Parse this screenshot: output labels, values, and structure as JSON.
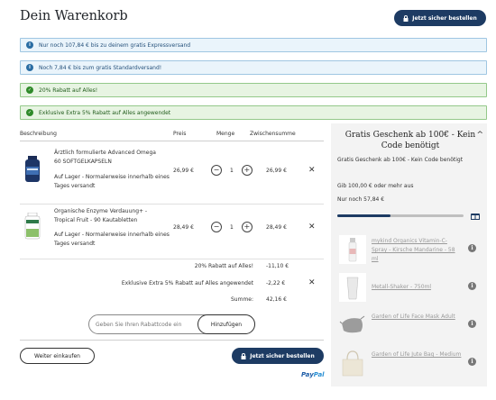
{
  "header": {
    "title": "Dein Warenkorb",
    "checkout_label": "Jetzt sicher bestellen"
  },
  "banners": [
    {
      "type": "info",
      "text": "Nur noch 107,84 € bis zu deinem gratis Expressversand"
    },
    {
      "type": "info",
      "text": "Noch 7,84 € bis zum gratis Standardversand!"
    },
    {
      "type": "success",
      "text": "20% Rabatt auf Alles!"
    },
    {
      "type": "success",
      "text": "Exklusive Extra 5% Rabatt auf Alles angewendet"
    }
  ],
  "table": {
    "headers": {
      "description": "Beschreibung",
      "price": "Preis",
      "quantity": "Menge",
      "subtotal": "Zwischensumme"
    },
    "items": [
      {
        "name": "Ärztlich formulierte Advanced Omega 60 SOFTGELKAPSELN",
        "stock": "Auf Lager  -  Normalerweise innerhalb eines Tages versandt",
        "price": "26,99 €",
        "quantity": "1",
        "subtotal": "26,99 €"
      },
      {
        "name": "Organische Enzyme Verdauung+ - Tropical Fruit - 90 Kautabletten",
        "stock": "Auf Lager  -  Normalerweise innerhalb eines Tages versandt",
        "price": "28,49 €",
        "quantity": "1",
        "subtotal": "28,49 €"
      }
    ],
    "discounts": [
      {
        "label": "20% Rabatt auf Alles!",
        "value": "-11,10 €"
      },
      {
        "label": "Exklusive Extra 5% Rabatt auf Alles angewendet",
        "value": "-2,22 €"
      }
    ],
    "total": {
      "label": "Summe:",
      "value": "42,16 €"
    }
  },
  "coupon": {
    "placeholder": "Geben Sie Ihren Rabattcode ein",
    "button_label": "Hinzufügen"
  },
  "footer": {
    "continue_label": "Weiter einkaufen",
    "checkout_label": "Jetzt sicher bestellen",
    "paypal_a": "Pay",
    "paypal_b": "Pal"
  },
  "gift_panel": {
    "title": "Gratis Geschenk ab 100€ - Kein Code benötigt",
    "subtitle": "Gratis Geschenk ab 100€ - Kein Code benötigt",
    "threshold": "Gib 100,00 € oder mehr aus",
    "remaining": "Nur noch 57,84 €",
    "progress_fraction": 0.42,
    "items": [
      {
        "name": "mykind Organics Vitamin-C-Spray - Kirsche Mandarine - 58 ml"
      },
      {
        "name": "Metall-Shaker - 750ml"
      },
      {
        "name": "Garden of Life Face Mask Adult"
      },
      {
        "name": "Garden of Life Jute Bag - Medium"
      }
    ]
  }
}
